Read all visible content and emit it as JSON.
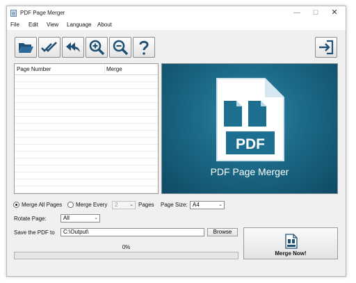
{
  "window": {
    "title": "PDF Page Merger",
    "controls": {
      "minimize": "—",
      "maximize": "☐",
      "close": "✕"
    }
  },
  "menu": [
    "File",
    "Edit",
    "View",
    "Language",
    "About"
  ],
  "toolbar": {
    "buttons": [
      {
        "icon": "open-folder-icon"
      },
      {
        "icon": "check-all-icon"
      },
      {
        "icon": "undo-all-icon"
      },
      {
        "icon": "zoom-in-icon"
      },
      {
        "icon": "zoom-out-icon"
      },
      {
        "icon": "help-icon"
      }
    ],
    "exit_icon": "exit-icon"
  },
  "table": {
    "columns": [
      "Page Number",
      "Merge"
    ],
    "rows": []
  },
  "preview": {
    "badge": "PDF",
    "caption": "PDF Page Merger"
  },
  "options": {
    "merge_all_label": "Merge All Pages",
    "merge_every_label": "Merge Every",
    "merge_every_value": "2",
    "pages_label": "Pages",
    "page_size_label": "Page Size:",
    "page_size_value": "A4",
    "rotate_label": "Rotate Page:",
    "rotate_value": "All",
    "save_label": "Save the PDF to",
    "save_path": "C:\\Output\\",
    "browse_label": "Browse",
    "merge_mode": "all"
  },
  "progress": {
    "label": "0%",
    "value": 0
  },
  "merge_button": {
    "label": "Merge Now!"
  },
  "colors": {
    "toolbar_icon": "#1f4f73",
    "preview_bg": "#1b6a87",
    "progress_fill": "#2fa84f"
  }
}
